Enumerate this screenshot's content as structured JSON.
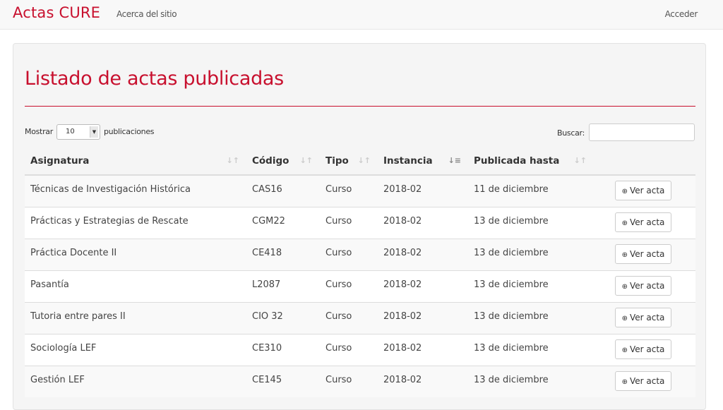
{
  "navbar": {
    "brand": "Actas CURE",
    "about": "Acerca del sitio",
    "login": "Acceder"
  },
  "page": {
    "title": "Listado de actas publicadas"
  },
  "controls": {
    "show_label": "Mostrar",
    "page_length": "10",
    "show_suffix": "publicaciones",
    "search_label": "Buscar:",
    "search_value": ""
  },
  "table": {
    "columns": [
      "Asignatura",
      "Código",
      "Tipo",
      "Instancia",
      "Publicada hasta"
    ],
    "sorted_column": "Instancia",
    "action_label": "Ver acta",
    "rows": [
      {
        "asignatura": "Técnicas de Investigación Histórica",
        "codigo": "CAS16",
        "tipo": "Curso",
        "instancia": "2018-02",
        "publicada_hasta": "11 de diciembre"
      },
      {
        "asignatura": "Prácticas y Estrategias de Rescate",
        "codigo": "CGM22",
        "tipo": "Curso",
        "instancia": "2018-02",
        "publicada_hasta": "13 de diciembre"
      },
      {
        "asignatura": "Práctica Docente II",
        "codigo": "CE418",
        "tipo": "Curso",
        "instancia": "2018-02",
        "publicada_hasta": "13 de diciembre"
      },
      {
        "asignatura": "Pasantía",
        "codigo": "L2087",
        "tipo": "Curso",
        "instancia": "2018-02",
        "publicada_hasta": "13 de diciembre"
      },
      {
        "asignatura": "Tutoria entre pares II",
        "codigo": "CIO 32",
        "tipo": "Curso",
        "instancia": "2018-02",
        "publicada_hasta": "13 de diciembre"
      },
      {
        "asignatura": "Sociología LEF",
        "codigo": "CE310",
        "tipo": "Curso",
        "instancia": "2018-02",
        "publicada_hasta": "13 de diciembre"
      },
      {
        "asignatura": "Gestión LEF",
        "codigo": "CE145",
        "tipo": "Curso",
        "instancia": "2018-02",
        "publicada_hasta": "13 de diciembre"
      }
    ]
  },
  "colors": {
    "brand": "#c8102e",
    "navbar_bg": "#f8f8f8",
    "panel_bg": "#f5f5f5"
  },
  "icons": {
    "view": "zoom-in-icon",
    "sort": "sort-icon",
    "sort_active": "sort-amount-asc-icon"
  }
}
